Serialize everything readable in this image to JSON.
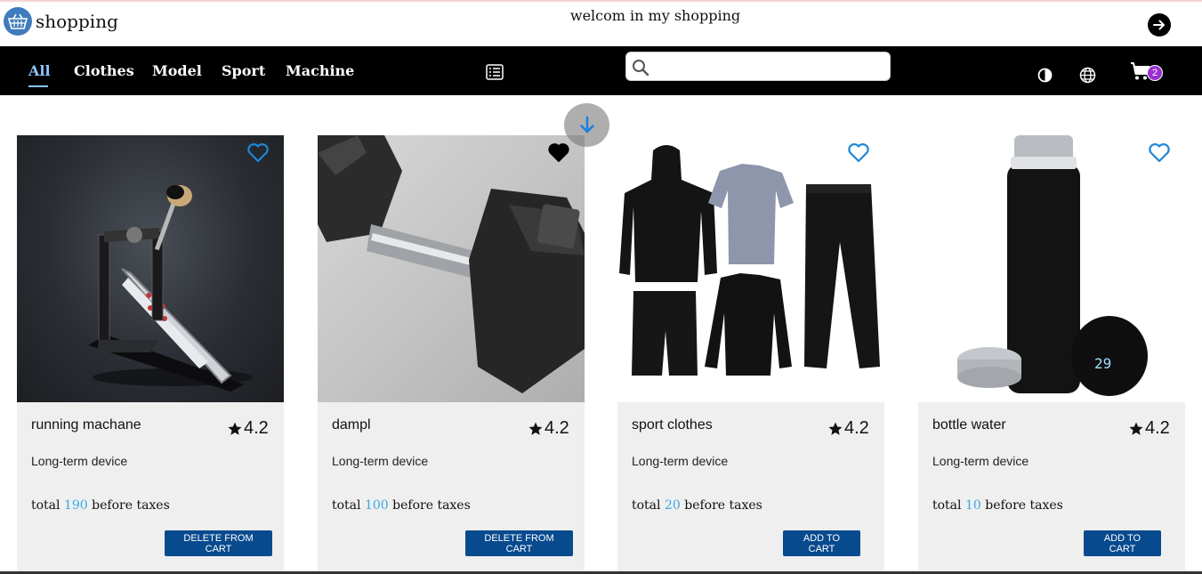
{
  "header": {
    "brand": "shopping",
    "welcome": "welcom in my shopping",
    "logout_icon": "arrow-right-circle-icon"
  },
  "nav": {
    "items": [
      {
        "label": "All",
        "active": true
      },
      {
        "label": "Clothes",
        "active": false
      },
      {
        "label": "Model",
        "active": false
      },
      {
        "label": "Sport",
        "active": false
      },
      {
        "label": "Machine",
        "active": false
      }
    ],
    "search_placeholder": "",
    "search_value": "",
    "cart_count": "2"
  },
  "colors": {
    "accent": "#39a9e8",
    "button": "#084a8e",
    "badge": "#9b30d0",
    "nav_active": "#8ec5ff"
  },
  "products": [
    {
      "name": "running machane",
      "rating": "4.2",
      "description": "Long-term device",
      "total_prefix": "total ",
      "price": "190",
      "total_suffix": " before taxes",
      "button": "DELETE FROM CART",
      "favorite": false,
      "image": "drum-pedal"
    },
    {
      "name": "dampl",
      "rating": "4.2",
      "description": "Long-term device",
      "total_prefix": "total ",
      "price": "100",
      "total_suffix": " before taxes",
      "button": "DELETE FROM CART",
      "favorite": true,
      "image": "dumbbell"
    },
    {
      "name": "sport clothes",
      "rating": "4.2",
      "description": "Long-term device",
      "total_prefix": "total ",
      "price": "20",
      "total_suffix": " before taxes",
      "button": "ADD TO CART",
      "favorite": false,
      "image": "sport-clothes-set"
    },
    {
      "name": "bottle water",
      "rating": "4.2",
      "description": "Long-term device",
      "total_prefix": "total ",
      "price": "10",
      "total_suffix": " before taxes",
      "button": "ADD TO CART",
      "favorite": false,
      "image": "thermos-bottle"
    }
  ]
}
